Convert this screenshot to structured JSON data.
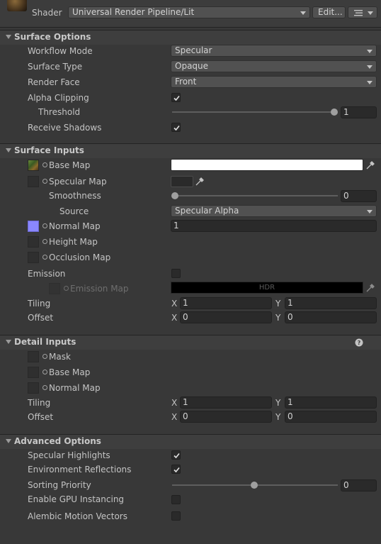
{
  "shader": {
    "label": "Shader",
    "value": "Universal Render Pipeline/Lit",
    "edit_button": "Edit..."
  },
  "surface_options": {
    "title": "Surface Options",
    "workflow_mode": {
      "label": "Workflow Mode",
      "value": "Specular"
    },
    "surface_type": {
      "label": "Surface Type",
      "value": "Opaque"
    },
    "render_face": {
      "label": "Render Face",
      "value": "Front"
    },
    "alpha_clipping": {
      "label": "Alpha Clipping",
      "checked": true
    },
    "threshold": {
      "label": "Threshold",
      "value": "1"
    },
    "receive_shadows": {
      "label": "Receive Shadows",
      "checked": true
    }
  },
  "surface_inputs": {
    "title": "Surface Inputs",
    "base_map": {
      "label": "Base Map",
      "color": "#FFFFFF"
    },
    "specular_map": {
      "label": "Specular Map"
    },
    "smoothness": {
      "label": "Smoothness",
      "value": "0"
    },
    "source": {
      "label": "Source",
      "value": "Specular Alpha"
    },
    "normal_map": {
      "label": "Normal Map",
      "value": "1",
      "swatch": "#8a87ff"
    },
    "height_map": {
      "label": "Height Map"
    },
    "occlusion_map": {
      "label": "Occlusion Map"
    },
    "emission": {
      "label": "Emission",
      "checked": false
    },
    "emission_map": {
      "label": "Emission Map",
      "hdr_label": "HDR"
    },
    "tiling": {
      "label": "Tiling",
      "x_label": "X",
      "x": "1",
      "y_label": "Y",
      "y": "1"
    },
    "offset": {
      "label": "Offset",
      "x_label": "X",
      "x": "0",
      "y_label": "Y",
      "y": "0"
    }
  },
  "detail_inputs": {
    "title": "Detail Inputs",
    "mask": {
      "label": "Mask"
    },
    "base_map": {
      "label": "Base Map"
    },
    "normal_map": {
      "label": "Normal Map"
    },
    "tiling": {
      "label": "Tiling",
      "x_label": "X",
      "x": "1",
      "y_label": "Y",
      "y": "1"
    },
    "offset": {
      "label": "Offset",
      "x_label": "X",
      "x": "0",
      "y_label": "Y",
      "y": "0"
    }
  },
  "advanced_options": {
    "title": "Advanced Options",
    "specular_highlights": {
      "label": "Specular Highlights",
      "checked": true
    },
    "environment_reflections": {
      "label": "Environment Reflections",
      "checked": true
    },
    "sorting_priority": {
      "label": "Sorting Priority",
      "value": "0"
    },
    "gpu_instancing": {
      "label": "Enable GPU Instancing",
      "checked": false
    },
    "alembic_motion_vectors": {
      "label": "Alembic Motion Vectors",
      "checked": false
    }
  },
  "icons": {
    "picker": "eyedropper-icon",
    "help": "help-icon",
    "foldout": "chevron-down-icon",
    "settings": "settings-menu-icon"
  },
  "colors": {
    "background": "#383838",
    "header": "#3e3e3e",
    "field": "#2a2a2a",
    "dropdown": "#515151"
  }
}
